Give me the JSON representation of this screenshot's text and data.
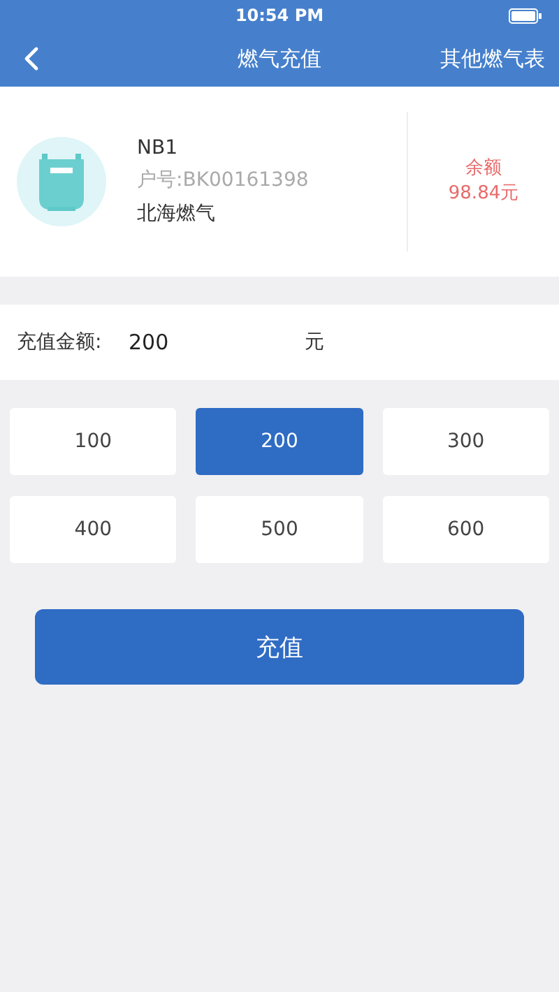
{
  "status_bar": {
    "time": "10:54 PM"
  },
  "nav": {
    "title": "燃气充值",
    "action": "其他燃气表"
  },
  "meter": {
    "name": "NB1",
    "account": "户号:BK00161398",
    "company": "北海燃气",
    "balance_label": "余额",
    "balance": "98.84元"
  },
  "amount": {
    "label": "充值金额:",
    "value": "200",
    "unit": "元"
  },
  "options": [
    {
      "label": "100",
      "selected": false
    },
    {
      "label": "200",
      "selected": true
    },
    {
      "label": "300",
      "selected": false
    },
    {
      "label": "400",
      "selected": false
    },
    {
      "label": "500",
      "selected": false
    },
    {
      "label": "600",
      "selected": false
    }
  ],
  "submit": "充值"
}
